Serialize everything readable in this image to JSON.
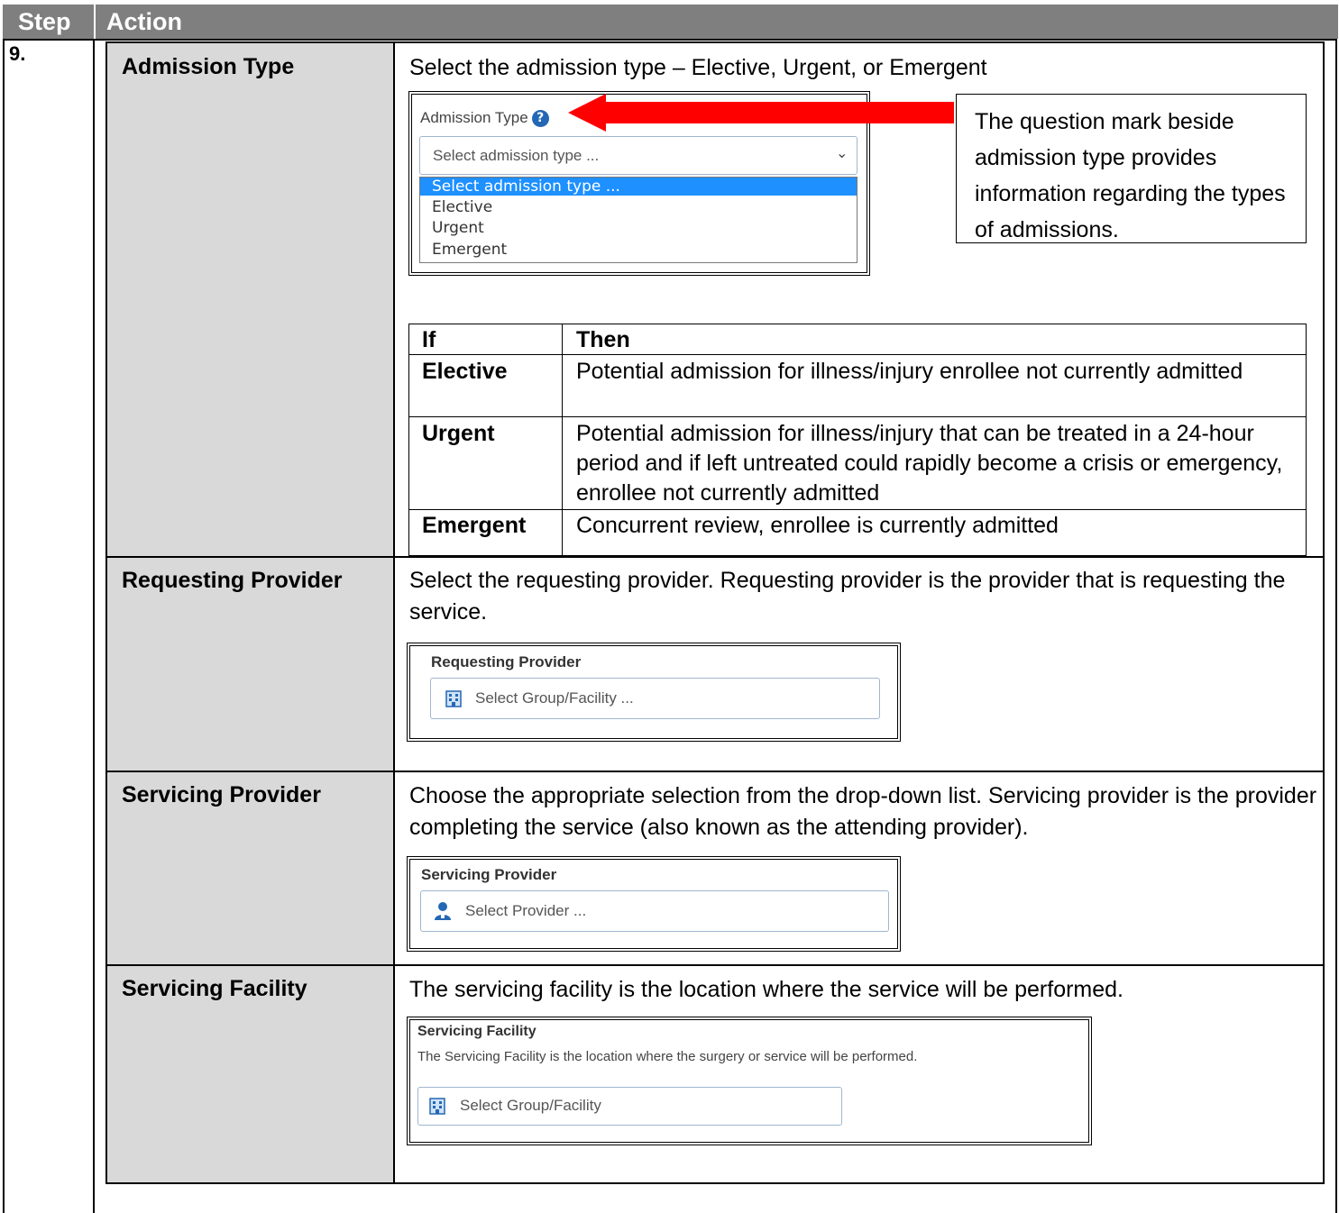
{
  "header": {
    "step": "Step",
    "action": "Action"
  },
  "step_number": "9.",
  "rows": {
    "admission": {
      "label": "Admission Type",
      "description": "Select the admission type – Elective, Urgent, or Emergent",
      "screenshot": {
        "field_label": "Admission Type",
        "placeholder": "Select admission type ...",
        "options": [
          "Select admission type ...",
          "Elective",
          "Urgent",
          "Emergent"
        ],
        "selected_color": "#1e90ff"
      },
      "callout": "The question mark beside admission type provides information regarding the types of admissions.",
      "arrow_color": "#ff0000",
      "table": {
        "headers": [
          "If",
          "Then"
        ],
        "rows": [
          {
            "if": "Elective",
            "then": "Potential admission for illness/injury enrollee not currently admitted"
          },
          {
            "if": "Urgent",
            "then": "Potential admission for illness/injury that can be treated in a 24-hour period and if left untreated could rapidly become a crisis or emergency, enrollee not currently admitted"
          },
          {
            "if": "Emergent",
            "then": "Concurrent review, enrollee is currently admitted"
          }
        ]
      }
    },
    "requesting": {
      "label": "Requesting Provider",
      "description": "Select the requesting provider. Requesting provider is the provider that is requesting the service.",
      "screenshot": {
        "field_label": "Requesting Provider",
        "placeholder": "Select Group/Facility ..."
      }
    },
    "servicing_provider": {
      "label": "Servicing Provider",
      "description": "Choose the appropriate selection from the drop-down list. Servicing provider is the provider completing the service (also known as the attending provider).",
      "screenshot": {
        "field_label": "Servicing Provider",
        "placeholder": "Select Provider ..."
      }
    },
    "servicing_facility": {
      "label": "Servicing Facility",
      "description": "The servicing facility is the location where the service will be performed.",
      "screenshot": {
        "field_label": "Servicing Facility",
        "help_text": "The Servicing Facility is the location where the surgery or service will be performed.",
        "placeholder": "Select Group/Facility"
      }
    }
  },
  "colors": {
    "header_bg": "#7f7f7f",
    "label_bg": "#d9d9d9",
    "icon_blue": "#2467b4"
  }
}
